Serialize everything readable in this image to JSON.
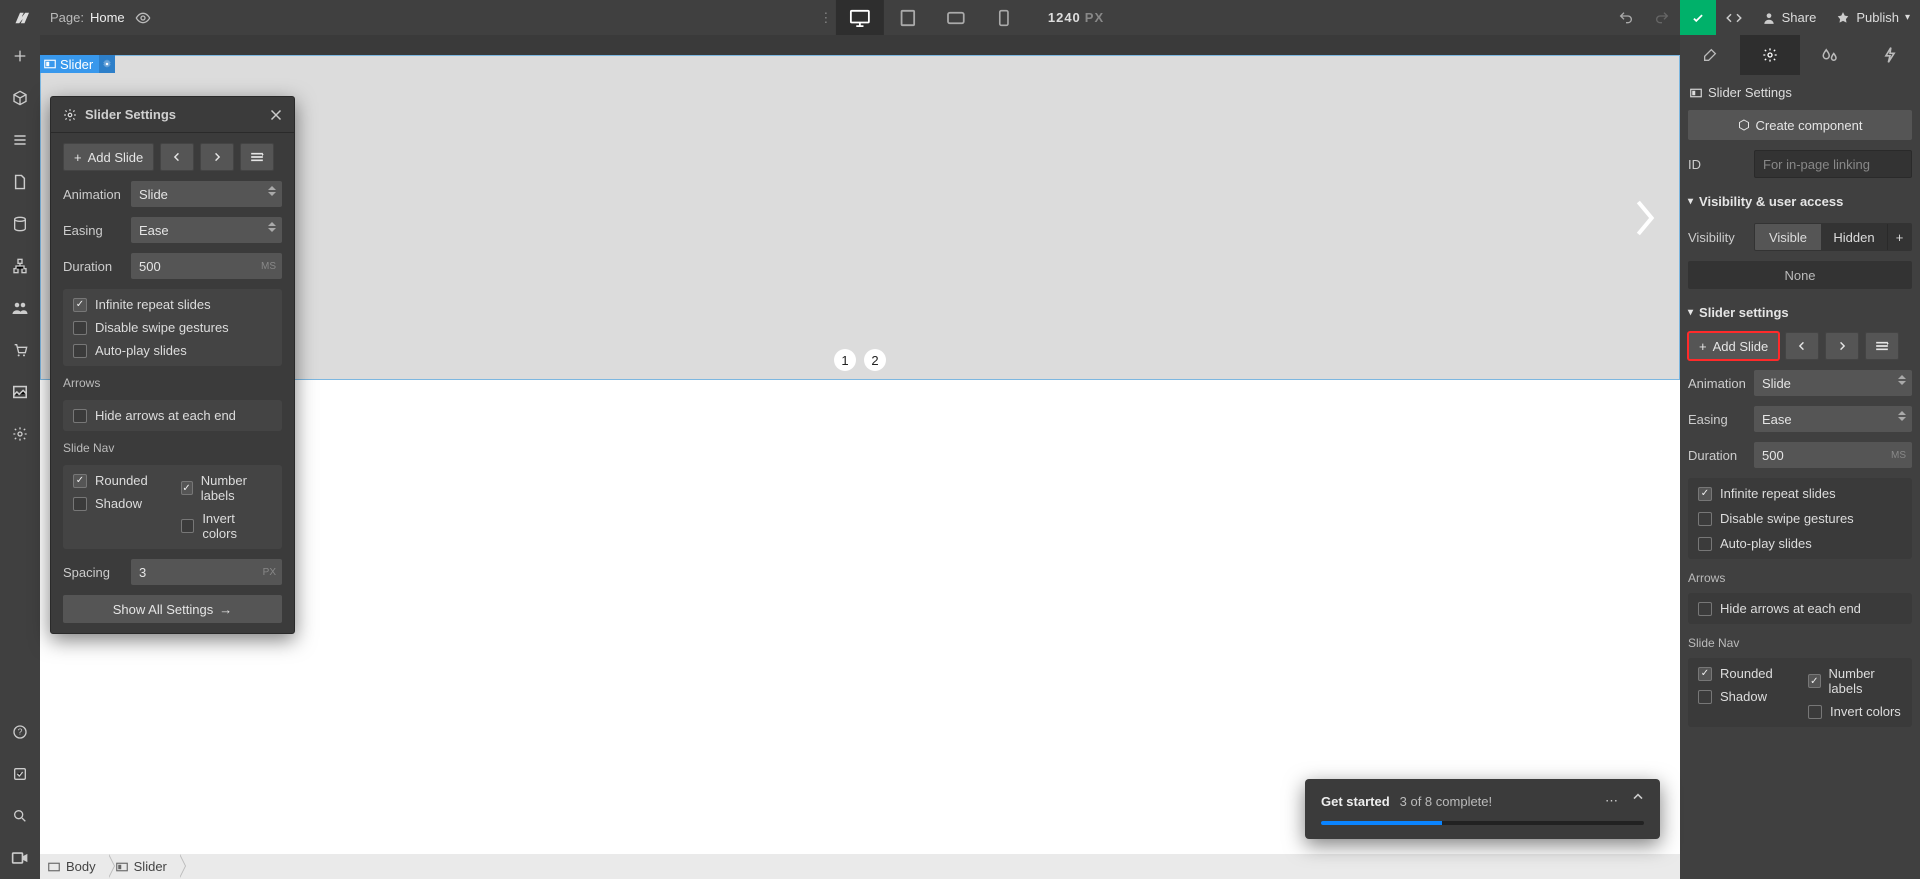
{
  "topbar": {
    "page_label": "Page:",
    "page_name": "Home",
    "canvas_width": "1240",
    "canvas_unit": "PX",
    "share": "Share",
    "publish": "Publish"
  },
  "canvas": {
    "element_tag": "Slider",
    "dots": [
      "1",
      "2"
    ]
  },
  "popover": {
    "title": "Slider Settings",
    "add_slide": "Add Slide",
    "animation_label": "Animation",
    "animation_value": "Slide",
    "easing_label": "Easing",
    "easing_value": "Ease",
    "duration_label": "Duration",
    "duration_value": "500",
    "duration_unit": "MS",
    "chk_repeat": "Infinite repeat slides",
    "chk_swipe": "Disable swipe gestures",
    "chk_autoplay": "Auto-play slides",
    "arrows_label": "Arrows",
    "chk_hide_arrows": "Hide arrows at each end",
    "slidenav_label": "Slide Nav",
    "chk_rounded": "Rounded",
    "chk_shadow": "Shadow",
    "chk_numlabels": "Number labels",
    "chk_invert": "Invert colors",
    "spacing_label": "Spacing",
    "spacing_value": "3",
    "spacing_unit": "PX",
    "show_all": "Show All Settings"
  },
  "rpanel": {
    "title": "Slider Settings",
    "create_component": "Create component",
    "id_label": "ID",
    "id_placeholder": "For in-page linking",
    "visibility_section": "Visibility & user access",
    "visibility_label": "Visibility",
    "visible": "Visible",
    "hidden": "Hidden",
    "none": "None",
    "slider_section": "Slider settings",
    "add_slide": "Add Slide",
    "animation_label": "Animation",
    "animation_value": "Slide",
    "easing_label": "Easing",
    "easing_value": "Ease",
    "duration_label": "Duration",
    "duration_value": "500",
    "duration_unit": "MS",
    "chk_repeat": "Infinite repeat slides",
    "chk_swipe": "Disable swipe gestures",
    "chk_autoplay": "Auto-play slides",
    "arrows_label": "Arrows",
    "chk_hide_arrows": "Hide arrows at each end",
    "slidenav_label": "Slide Nav",
    "chk_rounded": "Rounded",
    "chk_shadow": "Shadow",
    "chk_numlabels": "Number labels",
    "chk_invert": "Invert colors"
  },
  "toast": {
    "title": "Get started",
    "progress": "3 of 8 complete!",
    "percent": 37.5
  },
  "breadcrumb": {
    "body": "Body",
    "slider": "Slider"
  }
}
